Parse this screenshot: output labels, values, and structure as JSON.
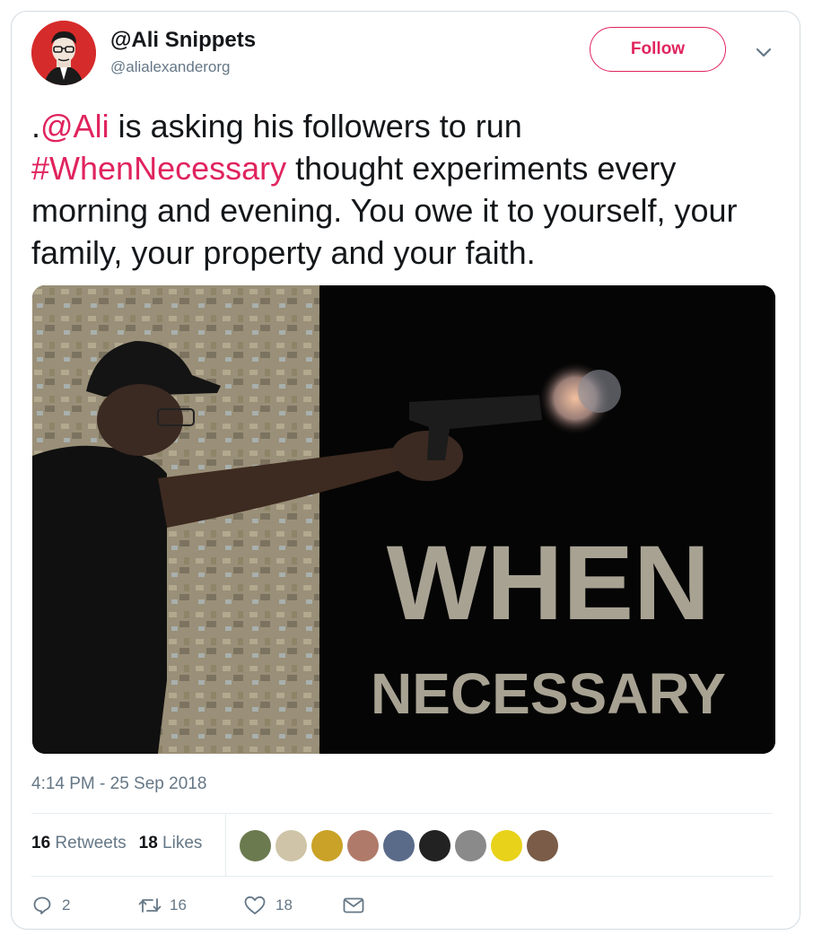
{
  "user": {
    "name": "@Ali Snippets",
    "handle": "@alialexanderorg",
    "follow_label": "Follow"
  },
  "tweet": {
    "prefix": ".",
    "mention": "@Ali",
    "part1": " is asking his followers to run ",
    "hashtag": "#WhenNecessary",
    "part2": " thought experiments every morning and evening. You owe it to yourself, your family, your property and your faith."
  },
  "media": {
    "line1": "WHEN",
    "line2": "NECESSARY"
  },
  "timestamp": "4:14 PM - 25 Sep 2018",
  "stats": {
    "retweets_count": "16",
    "retweets_label": "Retweets",
    "likes_count": "18",
    "likes_label": "Likes"
  },
  "likers": [
    "#6b7a4f",
    "#cfc4a8",
    "#c9a227",
    "#b07a6a",
    "#5a6b8a",
    "#222222",
    "#8a8a8a",
    "#e8d21a",
    "#7a5c48"
  ],
  "actions": {
    "reply_count": "2",
    "retweet_count": "16",
    "like_count": "18"
  },
  "colors": {
    "accent": "#e0245e",
    "secondary_text": "#657786",
    "primary_text": "#14171a"
  },
  "icons": [
    "chevron-down-icon",
    "reply-icon",
    "retweet-icon",
    "heart-icon",
    "message-icon"
  ]
}
